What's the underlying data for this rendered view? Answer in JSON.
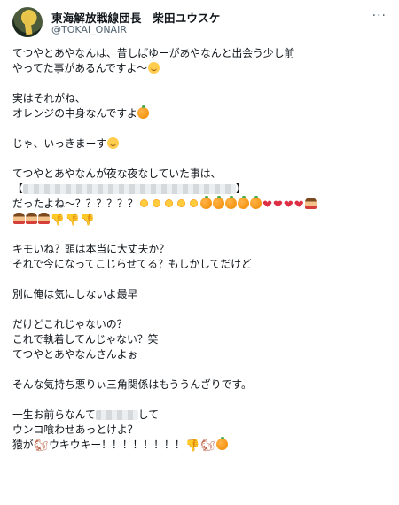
{
  "author": {
    "name": "東海解放戦線団長　柴田ユウスケ",
    "handle": "@TOKAI_ONAIR"
  },
  "more_icon": "more-horizontal-icon",
  "colors": {
    "text": "#0f1419",
    "secondary": "#536471"
  },
  "post": {
    "l1": "てつやとあやなんは、昔しばゆーがあやなんと出会う少し前",
    "l2": "やってた事があるんですよ～",
    "l3": "実はそれがね、",
    "l4": "オレンジの中身なんですよ",
    "l5": "じゃ、いっきまーす",
    "l6": "てつやとあやなんが夜な夜なしていた事は、",
    "l7a": "【",
    "l7b": "】",
    "l8": "だったよね～？？？？？？",
    "l10": "キモいね？頭は本当に大丈夫か？",
    "l11": "それで今になってこじらせてる？もしかしてだけど",
    "l12": "別に俺は気にしないよ最早",
    "l13": "だけどこれじゃないの？",
    "l14": "これで執着してんじゃない？笑",
    "l15": "てつやとあやなんさんよぉ",
    "l16": "そんな気持ち悪りぃ三角関係はもううんざりです。",
    "l17a": "一生お前らなんて",
    "l17b": "して",
    "l18": "ウンコ喰わせあっとけよ？",
    "l19a": "猿が",
    "l19b": "ウキウキー！！！！！！！！",
    "heart": "❤",
    "thumb": "👎",
    "squirrel": "🐿"
  }
}
